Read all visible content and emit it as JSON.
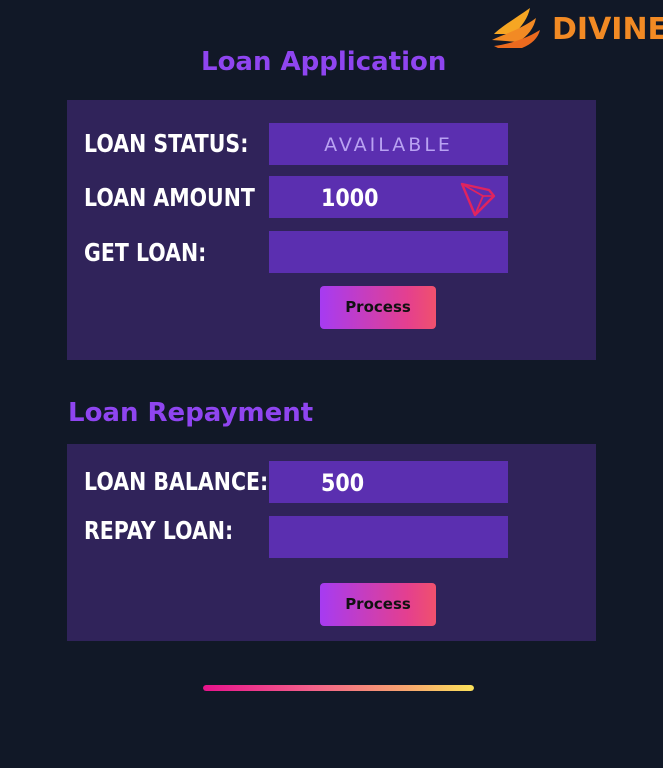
{
  "brand": {
    "name": "DIVINE",
    "logo_icon": "wing-icon",
    "color": "#f28a24"
  },
  "loan_application": {
    "title": "Loan Application",
    "status_label": "LOAN STATUS:",
    "status_value": "AVAILABLE",
    "amount_label": "LOAN AMOUNT",
    "amount_value": "1000",
    "currency_icon": "tron-icon",
    "get_loan_label": "GET LOAN:",
    "get_loan_value": "",
    "process_button": "Process"
  },
  "loan_repayment": {
    "title": "Loan Repayment",
    "balance_label": "LOAN BALANCE:",
    "balance_value": "500",
    "repay_label": "REPAY LOAN:",
    "repay_value": "",
    "process_button": "Process"
  },
  "progress": {
    "fraction": 1.0
  },
  "colors": {
    "background": "#111827",
    "panel": "#30235a",
    "field": "#5b2fb0",
    "title": "#8f45f0",
    "button_start": "#a63bf2",
    "button_end": "#f0516d"
  }
}
